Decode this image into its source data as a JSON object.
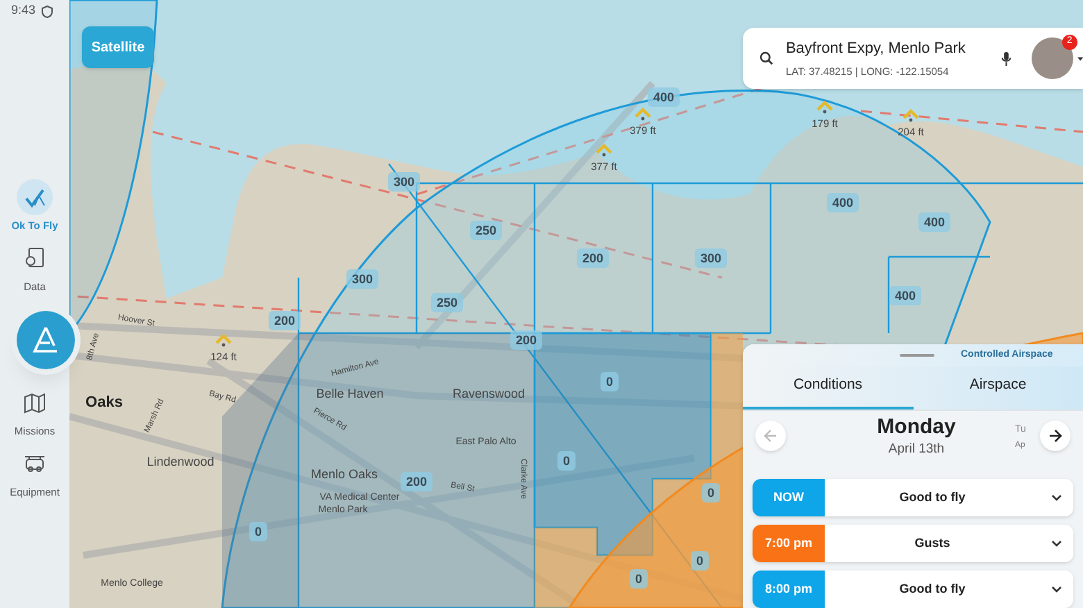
{
  "status_bar": {
    "time": "9:43"
  },
  "map": {
    "satellite_button": "Satellite",
    "grid_labels": [
      "400",
      "300",
      "250",
      "200",
      "300",
      "300",
      "250",
      "200",
      "200",
      "0",
      "0",
      "200",
      "0",
      "0",
      "0",
      "0",
      "400",
      "400",
      "400"
    ],
    "obstacle_labels": [
      "124 ft",
      "377 ft",
      "379 ft",
      "179 ft",
      "204 ft"
    ],
    "place_labels": [
      "Oaks",
      "Lindenwood",
      "Belle Haven",
      "Ravenswood",
      "Menlo Oaks",
      "VA Medical Center",
      "Menlo Park",
      "East Palo Alto",
      "Menlo College",
      "Hamilton Ave",
      "Bay Rd",
      "Pierce Rd",
      "Marsh Rd",
      "Hoover St",
      "8th Ave",
      "Bell St",
      "Clarke Ave"
    ]
  },
  "sidebar": {
    "items": [
      {
        "label": "Ok To Fly",
        "selected": true
      },
      {
        "label": "Data",
        "selected": false
      },
      {
        "label": "Missions",
        "selected": false
      },
      {
        "label": "Equipment",
        "selected": false
      }
    ]
  },
  "search": {
    "address": "Bayfront Expy, Menlo Park",
    "coordinates": "LAT: 37.48215 | LONG: -122.15054",
    "notification_count": "2"
  },
  "panel": {
    "airspace_type": "Controlled Airspace",
    "tabs": [
      {
        "label": "Conditions",
        "selected": true
      },
      {
        "label": "Airspace",
        "selected": false
      }
    ],
    "day": "Monday",
    "date": "April 13th",
    "next_day": "Tu",
    "next_date": "Ap",
    "forecasts": [
      {
        "time": "NOW",
        "status": "Good to fly",
        "color": "#0ea5e9"
      },
      {
        "time": "7:00 pm",
        "status": "Gusts",
        "color": "#f97316"
      },
      {
        "time": "8:00 pm",
        "status": "Good to fly",
        "color": "#0ea5e9"
      }
    ]
  }
}
